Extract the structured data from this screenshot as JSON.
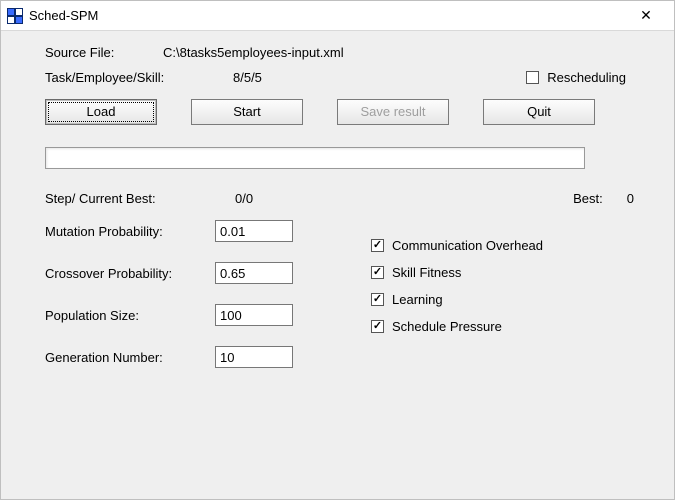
{
  "window": {
    "title": "Sched-SPM"
  },
  "source_file": {
    "label": "Source File:",
    "value": "C:\\8tasks5employees-input.xml"
  },
  "tes": {
    "label": "Task/Employee/Skill:",
    "value": "8/5/5"
  },
  "rescheduling": {
    "label": "Rescheduling",
    "checked": false
  },
  "buttons": {
    "load": "Load",
    "start": "Start",
    "save_result": "Save result",
    "quit": "Quit"
  },
  "step": {
    "label": "Step/ Current Best:",
    "value": "0/0"
  },
  "best": {
    "label": "Best:",
    "value": "0"
  },
  "params": {
    "mutation": {
      "label": "Mutation Probability:",
      "value": "0.01"
    },
    "crossover": {
      "label": "Crossover Probability:",
      "value": "0.65"
    },
    "population": {
      "label": "Population Size:",
      "value": "100"
    },
    "generation": {
      "label": "Generation Number:",
      "value": "10"
    }
  },
  "options": {
    "comm_overhead": {
      "label": "Communication Overhead",
      "checked": true
    },
    "skill_fitness": {
      "label": "Skill Fitness",
      "checked": true
    },
    "learning": {
      "label": "Learning",
      "checked": true
    },
    "schedule_press": {
      "label": "Schedule Pressure",
      "checked": true
    }
  }
}
